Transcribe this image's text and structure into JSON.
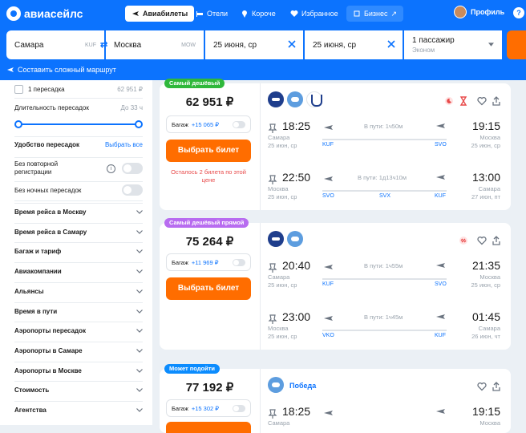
{
  "brand": {
    "name": "авиасейлс"
  },
  "nav": [
    {
      "label": "Авиабилеты",
      "icon": "plane-icon",
      "active": true
    },
    {
      "label": "Отели",
      "icon": "bed-icon"
    },
    {
      "label": "Короче",
      "icon": "pin-icon"
    },
    {
      "label": "Избранное",
      "icon": "heart-icon"
    },
    {
      "label": "Бизнес",
      "icon": "seat-icon"
    }
  ],
  "profile": {
    "label": "Профиль"
  },
  "search": {
    "from": "Самара",
    "from_code": "KUF",
    "to": "Москва",
    "to_code": "MOW",
    "date_there": "25 июня, ср",
    "date_back": "25 июня, ср",
    "passengers": "1 пассажир",
    "class": "Эконом"
  },
  "complex_route": "Составить сложный маршрут",
  "filters": {
    "one_stop": "1 пересадка",
    "one_stop_price": "62 951 ₽",
    "stop_duration": "Длительность пересадок",
    "stop_duration_value": "До 33 ч",
    "convenience": "Удобство пересадок",
    "select_all": "Выбрать все",
    "no_recheck": "Без повторной регистрации",
    "no_night": "Без ночных пересадок",
    "sections": [
      "Время рейса в Москву",
      "Время рейса в Самару",
      "Багаж и тариф",
      "Авиакомпании",
      "Альянсы",
      "Время в пути",
      "Аэропорты пересадок",
      "Аэропорты в Самаре",
      "Аэропорты в Москве",
      "Стоимость",
      "Агентства"
    ]
  },
  "tickets": [
    {
      "badge": "Самый дешёвый",
      "badge_color": "#2fb83b",
      "price": "62 951 ₽",
      "baggage": "Багаж",
      "baggage_price": "+15 065 ₽",
      "buy": "Выбрать билет",
      "warning": "Осталось 2 билета по этой цене",
      "segments": [
        {
          "dep": "18:25",
          "dep_city": "Самара",
          "dep_date": "25 июн, ср",
          "arr": "19:15",
          "arr_city": "Москва",
          "arr_date": "25 июн, ср",
          "duration": "В пути: 1ч50м",
          "codes": [
            "KUF",
            "SVO"
          ]
        },
        {
          "dep": "22:50",
          "dep_city": "Москва",
          "dep_date": "25 июн, ср",
          "arr": "13:00",
          "arr_city": "Самара",
          "arr_date": "27 июн, пт",
          "duration": "В пути: 1д13ч10м",
          "codes": [
            "SVO",
            "SVX",
            "KUF"
          ]
        }
      ]
    },
    {
      "badge": "Самый дешёвый прямой",
      "badge_color": "#b86cf0",
      "price": "75 264 ₽",
      "baggage": "Багаж",
      "baggage_price": "+11 969 ₽",
      "buy": "Выбрать билет",
      "segments": [
        {
          "dep": "20:40",
          "dep_city": "Самара",
          "dep_date": "25 июн, ср",
          "arr": "21:35",
          "arr_city": "Москва",
          "arr_date": "25 июн, ср",
          "duration": "В пути: 1ч55м",
          "codes": [
            "KUF",
            "SVO"
          ]
        },
        {
          "dep": "23:00",
          "dep_city": "Москва",
          "dep_date": "25 июн, ср",
          "arr": "01:45",
          "arr_city": "Самара",
          "arr_date": "26 июн, чт",
          "duration": "В пути: 1ч45м",
          "codes": [
            "VKO",
            "KUF"
          ]
        }
      ]
    },
    {
      "badge": "Может подойти",
      "badge_color": "#0c8cfe",
      "price": "77 192 ₽",
      "baggage": "Багаж",
      "baggage_price": "+15 302 ₽",
      "airline": "Победа",
      "segments": [
        {
          "dep": "18:25",
          "dep_city": "Самара",
          "arr": "19:15",
          "arr_city": "Москва"
        }
      ]
    }
  ]
}
